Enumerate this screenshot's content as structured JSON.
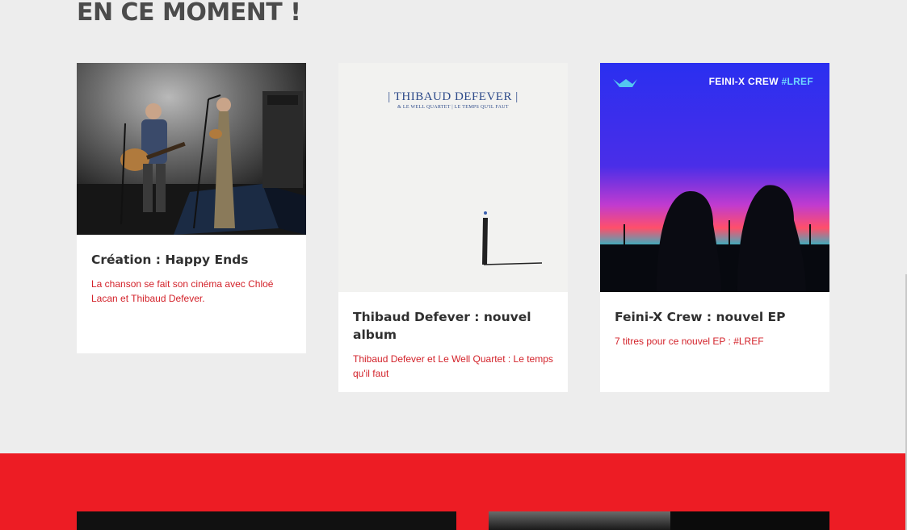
{
  "section": {
    "title": "EN CE MOMENT !"
  },
  "cards": [
    {
      "title": "Création : Happy Ends",
      "excerpt": "La chanson se fait son cinéma avec Chloé Lacan et Thibaud Defever."
    },
    {
      "title": "Thibaud Defever : nouvel album",
      "excerpt": "Thibaud Defever et Le Well Quartet : Le temps qu'il faut",
      "cover": {
        "artist": "| THIBAUD DEFEVER |",
        "subtitle": "& LE WELL QUARTET | LE TEMPS QU'IL FAUT"
      }
    },
    {
      "title": "Feini-X Crew : nouvel EP",
      "excerpt": "7 titres pour ce nouvel EP : #LREF",
      "cover": {
        "name": "FEINI-X CREW",
        "tag": "#LREF"
      }
    }
  ],
  "colors": {
    "accent": "#ed1c24",
    "excerpt": "#d3222a",
    "title": "#4b4b4b",
    "background": "#ededed"
  }
}
